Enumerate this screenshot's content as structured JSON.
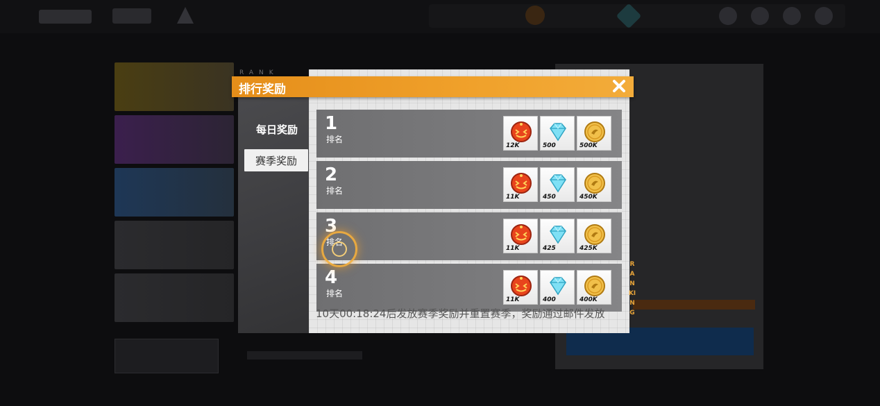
{
  "modal": {
    "title": "排行奖励",
    "close_icon": "close-icon",
    "side_label": "RANK",
    "vertical_label": "RANKING",
    "accent_color": "#f0a12b"
  },
  "tabs": [
    {
      "label": "每日奖励",
      "selected": false
    },
    {
      "label": "赛季奖励",
      "selected": true
    }
  ],
  "ranks": [
    {
      "rank": "1",
      "label": "排名",
      "rewards": [
        {
          "icon": "pumpkin-token-icon",
          "amount": "12K"
        },
        {
          "icon": "diamond-icon",
          "amount": "500"
        },
        {
          "icon": "gold-coin-icon",
          "amount": "500K"
        }
      ]
    },
    {
      "rank": "2",
      "label": "排名",
      "rewards": [
        {
          "icon": "pumpkin-token-icon",
          "amount": "11K"
        },
        {
          "icon": "diamond-icon",
          "amount": "450"
        },
        {
          "icon": "gold-coin-icon",
          "amount": "450K"
        }
      ]
    },
    {
      "rank": "3",
      "label": "排名",
      "rewards": [
        {
          "icon": "pumpkin-token-icon",
          "amount": "11K"
        },
        {
          "icon": "diamond-icon",
          "amount": "425"
        },
        {
          "icon": "gold-coin-icon",
          "amount": "425K"
        }
      ]
    },
    {
      "rank": "4",
      "label": "排名",
      "rewards": [
        {
          "icon": "pumpkin-token-icon",
          "amount": "11K"
        },
        {
          "icon": "diamond-icon",
          "amount": "400"
        },
        {
          "icon": "gold-coin-icon",
          "amount": "400K"
        }
      ]
    }
  ],
  "footer_note": "10天00:18:24后发放赛季奖励并重置赛季，奖励通过邮件发放"
}
